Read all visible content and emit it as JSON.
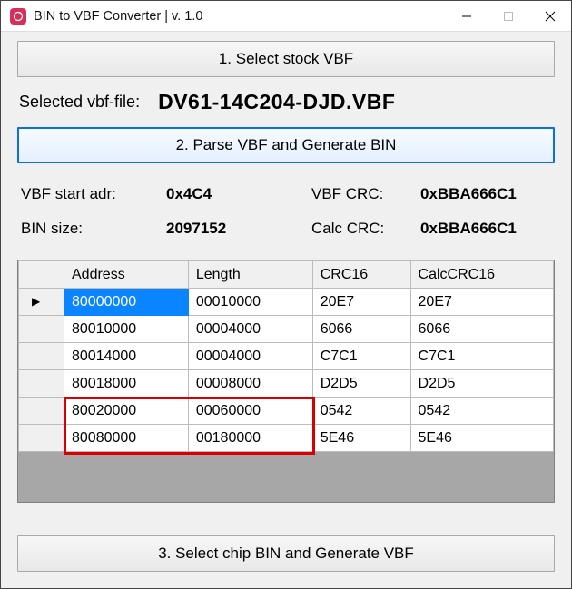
{
  "window": {
    "title": "BIN to VBF Converter | v. 1.0"
  },
  "buttons": {
    "step1": "1. Select stock VBF",
    "step2": "2. Parse VBF and Generate BIN",
    "step3": "3. Select chip BIN and Generate VBF"
  },
  "selected": {
    "label": "Selected vbf-file:",
    "value": "DV61-14C204-DJD.VBF"
  },
  "info": {
    "vbf_start_label": "VBF start adr:",
    "vbf_start_value": "0x4C4",
    "vbf_crc_label": "VBF CRC:",
    "vbf_crc_value": "0xBBA666C1",
    "bin_size_label": "BIN size:",
    "bin_size_value": "2097152",
    "calc_crc_label": "Calc CRC:",
    "calc_crc_value": "0xBBA666C1"
  },
  "table": {
    "headers": {
      "address": "Address",
      "length": "Length",
      "crc16": "CRC16",
      "calccrc16": "CalcCRC16"
    },
    "rows": [
      {
        "address": "80000000",
        "length": "00010000",
        "crc16": "20E7",
        "calccrc16": "20E7"
      },
      {
        "address": "80010000",
        "length": "00004000",
        "crc16": "6066",
        "calccrc16": "6066"
      },
      {
        "address": "80014000",
        "length": "00004000",
        "crc16": "C7C1",
        "calccrc16": "C7C1"
      },
      {
        "address": "80018000",
        "length": "00008000",
        "crc16": "D2D5",
        "calccrc16": "D2D5"
      },
      {
        "address": "80020000",
        "length": "00060000",
        "crc16": "0542",
        "calccrc16": "0542"
      },
      {
        "address": "80080000",
        "length": "00180000",
        "crc16": "5E46",
        "calccrc16": "5E46"
      }
    ],
    "selected_row": 0,
    "highlight_rows": [
      4,
      5
    ]
  }
}
